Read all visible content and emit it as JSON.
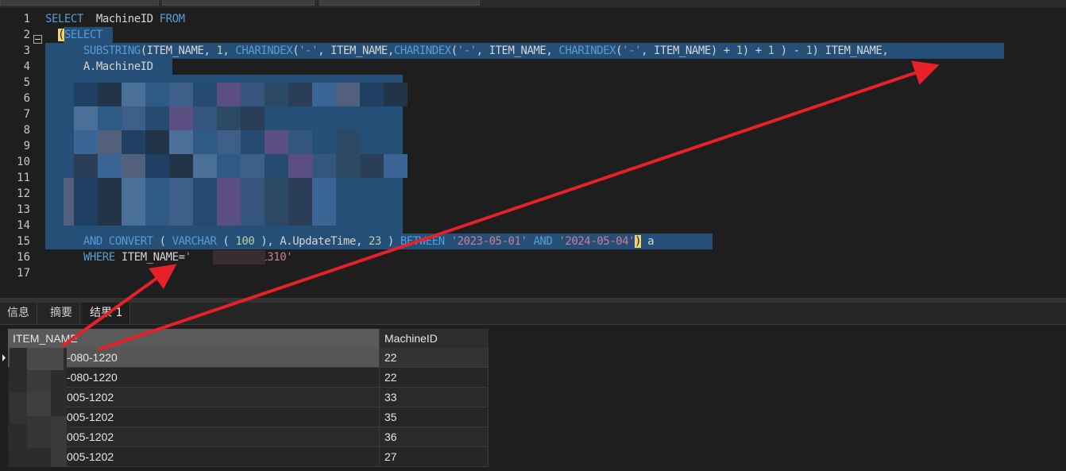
{
  "editor": {
    "lines": [
      {
        "n": "1",
        "segments": [
          {
            "t": "SELECT ",
            "c": "kw"
          },
          {
            "t": " MachineID ",
            "c": ""
          },
          {
            "t": "FROM",
            "c": "kw"
          }
        ]
      },
      {
        "n": "2",
        "segments": [
          {
            "t": "  ",
            "c": ""
          },
          {
            "t": "(",
            "c": "paren-hl"
          },
          {
            "t": "SELECT",
            "c": "kw"
          }
        ]
      },
      {
        "n": "3",
        "segments": [
          {
            "t": "      ",
            "c": ""
          },
          {
            "t": "SUBSTRING",
            "c": "fn"
          },
          {
            "t": "(ITEM_NAME, ",
            "c": ""
          },
          {
            "t": "1",
            "c": "num"
          },
          {
            "t": ", ",
            "c": ""
          },
          {
            "t": "CHARINDEX",
            "c": "fn"
          },
          {
            "t": "(",
            "c": ""
          },
          {
            "t": "'-'",
            "c": "str"
          },
          {
            "t": ", ITEM_NAME,",
            "c": ""
          },
          {
            "t": "CHARINDEX",
            "c": "fn"
          },
          {
            "t": "(",
            "c": ""
          },
          {
            "t": "'-'",
            "c": "str"
          },
          {
            "t": ", ITEM_NAME, ",
            "c": ""
          },
          {
            "t": "CHARINDEX",
            "c": "fn"
          },
          {
            "t": "(",
            "c": ""
          },
          {
            "t": "'-'",
            "c": "str"
          },
          {
            "t": ", ITEM_NAME) + ",
            "c": ""
          },
          {
            "t": "1",
            "c": "num"
          },
          {
            "t": ") + ",
            "c": ""
          },
          {
            "t": "1",
            "c": "num"
          },
          {
            "t": " ) - ",
            "c": ""
          },
          {
            "t": "1",
            "c": "num"
          },
          {
            "t": ") ITEM_NAME,",
            "c": ""
          }
        ]
      },
      {
        "n": "4",
        "segments": [
          {
            "t": "      A.MachineID",
            "c": ""
          }
        ]
      },
      {
        "n": "5",
        "segments": []
      },
      {
        "n": "6",
        "segments": []
      },
      {
        "n": "7",
        "segments": []
      },
      {
        "n": "8",
        "segments": []
      },
      {
        "n": "9",
        "segments": []
      },
      {
        "n": "10",
        "segments": []
      },
      {
        "n": "11",
        "segments": []
      },
      {
        "n": "12",
        "segments": []
      },
      {
        "n": "13",
        "segments": []
      },
      {
        "n": "14",
        "segments": []
      },
      {
        "n": "15",
        "segments": [
          {
            "t": "      ",
            "c": ""
          },
          {
            "t": "AND",
            "c": "kw"
          },
          {
            "t": " ",
            "c": ""
          },
          {
            "t": "CONVERT",
            "c": "fn"
          },
          {
            "t": " ( ",
            "c": ""
          },
          {
            "t": "VARCHAR",
            "c": "kw"
          },
          {
            "t": " ( ",
            "c": ""
          },
          {
            "t": "100",
            "c": "num"
          },
          {
            "t": " ), A.UpdateTime, ",
            "c": ""
          },
          {
            "t": "23",
            "c": "num"
          },
          {
            "t": " ) ",
            "c": ""
          },
          {
            "t": "BETWEEN",
            "c": "kw"
          },
          {
            "t": " ",
            "c": ""
          },
          {
            "t": "'2023-05-01'",
            "c": "str"
          },
          {
            "t": " ",
            "c": ""
          },
          {
            "t": "AND",
            "c": "kw"
          },
          {
            "t": " ",
            "c": ""
          },
          {
            "t": "'2024-05-04'",
            "c": "str"
          },
          {
            "t": ")",
            "c": "paren-hl"
          },
          {
            "t": " a",
            "c": ""
          }
        ]
      },
      {
        "n": "16",
        "segments": [
          {
            "t": "      ",
            "c": ""
          },
          {
            "t": "WHERE",
            "c": "kw"
          },
          {
            "t": " ITEM_NAME=",
            "c": ""
          },
          {
            "t": "'       )25-1310'",
            "c": "str"
          }
        ]
      },
      {
        "n": "17",
        "segments": []
      }
    ]
  },
  "result_tabs": [
    {
      "label": "信息",
      "active": false
    },
    {
      "label": "摘要",
      "active": false
    },
    {
      "label": "结果 1",
      "active": true
    }
  ],
  "grid": {
    "columns": [
      {
        "label": "ITEM_NAME"
      },
      {
        "label": "MachineID"
      }
    ],
    "rows": [
      {
        "item": "-080-1220",
        "machine": "22",
        "current": true
      },
      {
        "item": "-080-1220",
        "machine": "22",
        "current": false
      },
      {
        "item": "005-1202",
        "machine": "33",
        "current": false
      },
      {
        "item": "005-1202",
        "machine": "35",
        "current": false
      },
      {
        "item": "005-1202",
        "machine": "36",
        "current": false
      },
      {
        "item": "005-1202",
        "machine": "27",
        "current": false
      }
    ]
  },
  "colors": {
    "selection": "#264f78",
    "arrow": "#e8202a",
    "keyword": "#569cd6",
    "string": "#ce7b93",
    "number": "#b5cea8"
  }
}
